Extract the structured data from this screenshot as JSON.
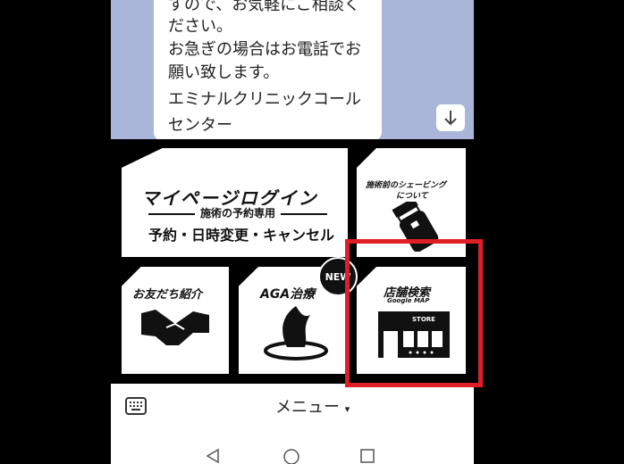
{
  "chat": {
    "lines": [
      "すので、お気軽にご相談く",
      "ださい。",
      "お急ぎの場合はお電話でお",
      "願い致します。",
      "エミナルクリニックコール",
      "センター"
    ],
    "scroll_icon": "arrow-down-icon"
  },
  "rich_menu": {
    "login": {
      "title": "マイページログイン",
      "subtitle": "施術の予約専用",
      "actions": "予約・日時変更・キャンセル"
    },
    "shaving": {
      "title_line1": "施術前のシェービング",
      "title_line2": "について",
      "icon": "electric-shaver-icon"
    },
    "friend": {
      "title": "お友だち紹介",
      "icon": "handshake-icon"
    },
    "aga": {
      "title": "AGA治療",
      "badge": "NEW",
      "icon": "hair-icon"
    },
    "store": {
      "title": "店舗検索",
      "subtitle": "Google MAP",
      "sign": "STORE",
      "icon": "storefront-icon"
    },
    "highlight_color": "#e01e25"
  },
  "footer": {
    "menu_label": "メニュー",
    "menu_caret": "▾",
    "keyboard_icon": "keyboard-icon"
  },
  "navbar": {
    "back_icon": "back-triangle-icon",
    "home_icon": "home-circle-icon",
    "recents_icon": "recents-square-icon"
  }
}
